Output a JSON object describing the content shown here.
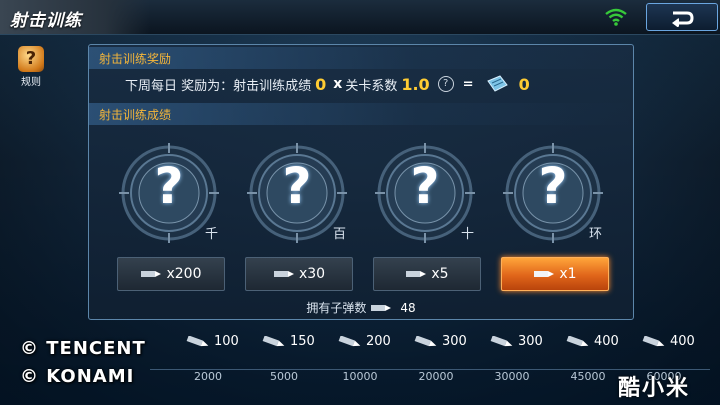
{
  "header": {
    "title": "射击训练"
  },
  "rules": {
    "label": "规则"
  },
  "reward_section": {
    "title": "射击训练奖励",
    "prefix": "下周每日 奖励为：射击训练成绩",
    "score": "0",
    "multiply": "x",
    "factor_label": "关卡系数",
    "factor_value": "1.0",
    "help": "?",
    "equals": "=",
    "result": "0"
  },
  "score_section": {
    "title": "射击训练成绩",
    "targets": [
      {
        "symbol": "?",
        "unit": "千"
      },
      {
        "symbol": "?",
        "unit": "百"
      },
      {
        "symbol": "?",
        "unit": "十"
      },
      {
        "symbol": "?",
        "unit": "环"
      }
    ]
  },
  "multipliers": [
    {
      "label": "x200",
      "active": false
    },
    {
      "label": "x30",
      "active": false
    },
    {
      "label": "x5",
      "active": false
    },
    {
      "label": "x1",
      "active": true
    }
  ],
  "owned": {
    "label": "拥有子弹数",
    "value": "48"
  },
  "track": {
    "rewards": [
      "100",
      "150",
      "200",
      "300",
      "300",
      "400",
      "400"
    ],
    "thresholds": [
      "2000",
      "5000",
      "10000",
      "20000",
      "30000",
      "45000",
      "60000"
    ]
  },
  "watermarks": {
    "line1": "© TENCENT",
    "line2": "© KONAMI",
    "brand": "酷小米"
  },
  "colors": {
    "accent_orange": "#ff9a2e",
    "gold": "#ffcc33",
    "section_title": "#f5b63a"
  }
}
